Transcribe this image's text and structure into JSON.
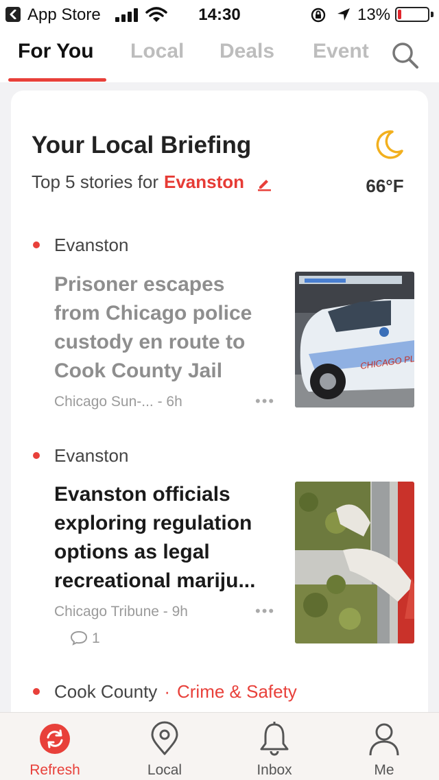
{
  "status_bar": {
    "carrier": "App Store",
    "time": "14:30",
    "battery": "13%"
  },
  "tabs": [
    {
      "label": "For You",
      "active": true
    },
    {
      "label": "Local",
      "active": false
    },
    {
      "label": "Deals",
      "active": false
    },
    {
      "label": "Event",
      "active": false
    }
  ],
  "briefing": {
    "title": "Your Local Briefing",
    "subtitle_prefix": "Top 5 stories for",
    "city": "Evanston",
    "temperature": "66°F",
    "weather_icon": "moon-icon"
  },
  "stories": [
    {
      "location": "Evanston",
      "headline": "Prisoner escapes from Chicago police custody en route to Cook County Jail",
      "source": "Chicago Sun-... - 6h",
      "more": "•••",
      "read": true
    },
    {
      "location": "Evanston",
      "headline": "Evanston officials exploring regulation options as legal recreational mariju...",
      "source": "Chicago Tribune - 9h",
      "more": "•••",
      "comments": "1",
      "read": false
    },
    {
      "location": "Cook County",
      "separator": "·",
      "category": "Crime & Safety"
    }
  ],
  "bottom_nav": [
    {
      "label": "Refresh",
      "icon": "refresh-icon",
      "active": true
    },
    {
      "label": "Local",
      "icon": "location-pin-icon",
      "active": false
    },
    {
      "label": "Inbox",
      "icon": "bell-icon",
      "active": false
    },
    {
      "label": "Me",
      "icon": "person-icon",
      "active": false
    }
  ],
  "colors": {
    "accent": "#e8403a",
    "weather": "#f2b01e"
  }
}
